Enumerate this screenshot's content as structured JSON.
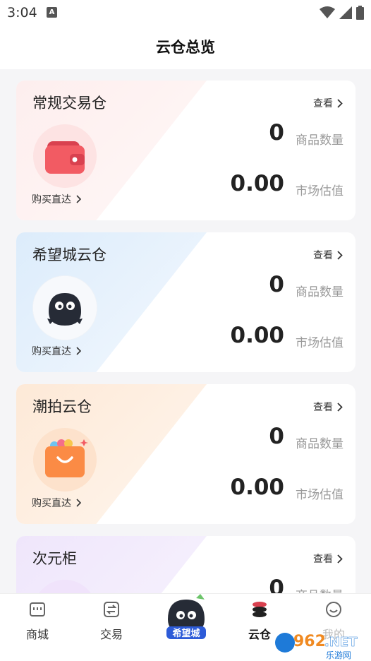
{
  "status_bar": {
    "time": "3:04",
    "notification_letter": "A"
  },
  "header": {
    "title": "云仓总览"
  },
  "colors": {
    "accent": "#e84a57",
    "active_nav": "#1a1a1a"
  },
  "cards": [
    {
      "title": "常规交易仓",
      "view_label": "查看",
      "count": "0",
      "count_label": "商品数量",
      "value": "0.00",
      "value_label": "市场估值",
      "buy_label": "购买直达",
      "icon": "wallet-icon"
    },
    {
      "title": "希望城云仓",
      "view_label": "查看",
      "count": "0",
      "count_label": "商品数量",
      "value": "0.00",
      "value_label": "市场估值",
      "buy_label": "购买直达",
      "icon": "mascot-icon"
    },
    {
      "title": "潮拍云仓",
      "view_label": "查看",
      "count": "0",
      "count_label": "商品数量",
      "value": "0.00",
      "value_label": "市场估值",
      "buy_label": "购买直达",
      "icon": "shopping-bag-icon"
    },
    {
      "title": "次元柜",
      "view_label": "查看",
      "count": "0",
      "count_label": "商品数量",
      "icon": "cabinet-icon"
    }
  ],
  "bottom_nav": {
    "items": [
      {
        "label": "商城",
        "icon": "store-icon"
      },
      {
        "label": "交易",
        "icon": "exchange-icon"
      },
      {
        "label": "希望城",
        "icon": "mascot-logo-icon"
      },
      {
        "label": "云仓",
        "icon": "database-stack-icon",
        "active": true
      },
      {
        "label": "我的",
        "icon": "smile-icon"
      }
    ]
  },
  "watermark": {
    "text_number": "962",
    "text_suffix": ".NET",
    "text_sub": "乐游网"
  }
}
